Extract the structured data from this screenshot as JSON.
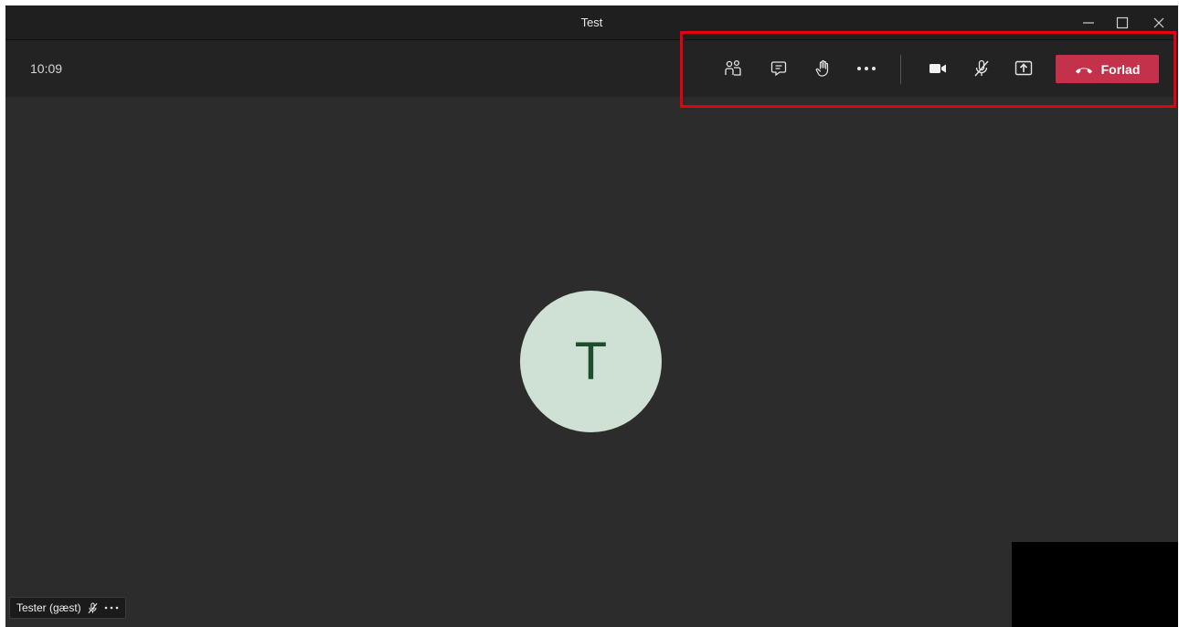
{
  "window": {
    "title": "Test",
    "controls": [
      "minimize",
      "maximize",
      "close"
    ]
  },
  "meeting": {
    "duration": "10:09"
  },
  "toolbar": {
    "buttons": [
      {
        "id": "participants",
        "icon": "people-icon"
      },
      {
        "id": "chat",
        "icon": "chat-icon"
      },
      {
        "id": "raise-hand",
        "icon": "hand-icon"
      },
      {
        "id": "more",
        "icon": "more-icon"
      },
      {
        "id": "camera",
        "icon": "camera-icon"
      },
      {
        "id": "mic",
        "icon": "mic-off-icon",
        "state": "muted"
      },
      {
        "id": "share",
        "icon": "share-screen-icon"
      }
    ],
    "leave_label": "Forlad"
  },
  "participant": {
    "initial": "T",
    "name": "Tester (gæst)",
    "muted": true
  },
  "colors": {
    "background": "#2d2c2c",
    "toolbar": "#242323",
    "leave_button": "#c4314b",
    "avatar_bg": "#cfe0d4",
    "avatar_text": "#1d4d2c",
    "highlight_box": "#e3000f"
  }
}
